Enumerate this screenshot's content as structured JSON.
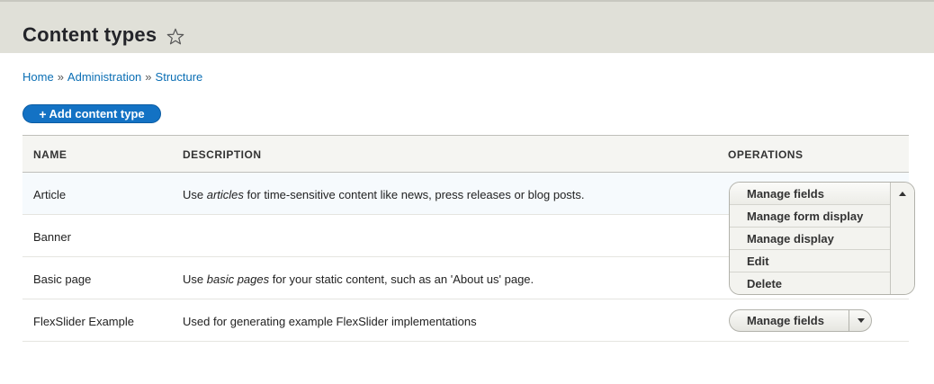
{
  "header": {
    "title": "Content types"
  },
  "breadcrumb": {
    "items": [
      "Home",
      "Administration",
      "Structure"
    ],
    "separator": "»"
  },
  "actions": {
    "add_label": "Add content type",
    "add_plus": "+"
  },
  "table": {
    "headers": [
      "NAME",
      "DESCRIPTION",
      "OPERATIONS"
    ],
    "rows": [
      {
        "name": "Article",
        "desc_pre": "Use ",
        "desc_em": "articles",
        "desc_post": " for time-sensitive content like news, press releases or blog posts.",
        "operation": "Manage fields"
      },
      {
        "name": "Banner",
        "desc_pre": "",
        "desc_em": "",
        "desc_post": "",
        "operation": ""
      },
      {
        "name": "Basic page",
        "desc_pre": "Use ",
        "desc_em": "basic pages",
        "desc_post": " for your static content, such as an 'About us' page.",
        "operation": ""
      },
      {
        "name": "FlexSlider Example",
        "desc_pre": "Used for generating example FlexSlider implementations",
        "desc_em": "",
        "desc_post": "",
        "operation": "Manage fields"
      }
    ]
  },
  "operations_dropdown": {
    "items": [
      "Manage fields",
      "Manage form display",
      "Manage display",
      "Edit",
      "Delete"
    ]
  },
  "colors": {
    "accent": "#1372c4",
    "link": "#0a6eb4",
    "header_bg": "#e0e0d8"
  }
}
